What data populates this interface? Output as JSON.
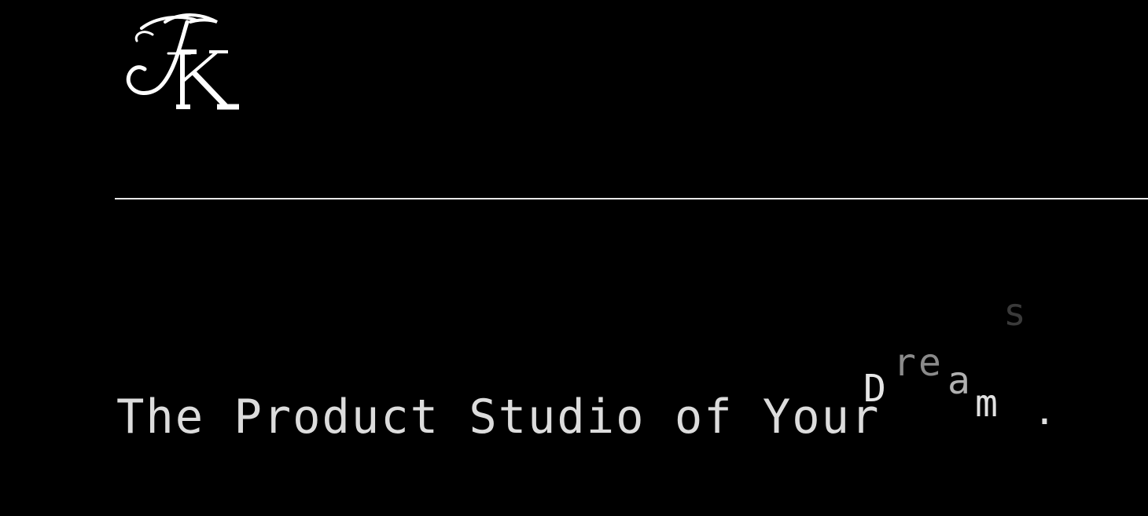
{
  "brand": {
    "logo_text": "FK"
  },
  "hero": {
    "headline_prefix": "The Product Studio of Your",
    "animated_word_letters": [
      "D",
      "r",
      "e",
      "a",
      "m",
      "s",
      "."
    ]
  }
}
